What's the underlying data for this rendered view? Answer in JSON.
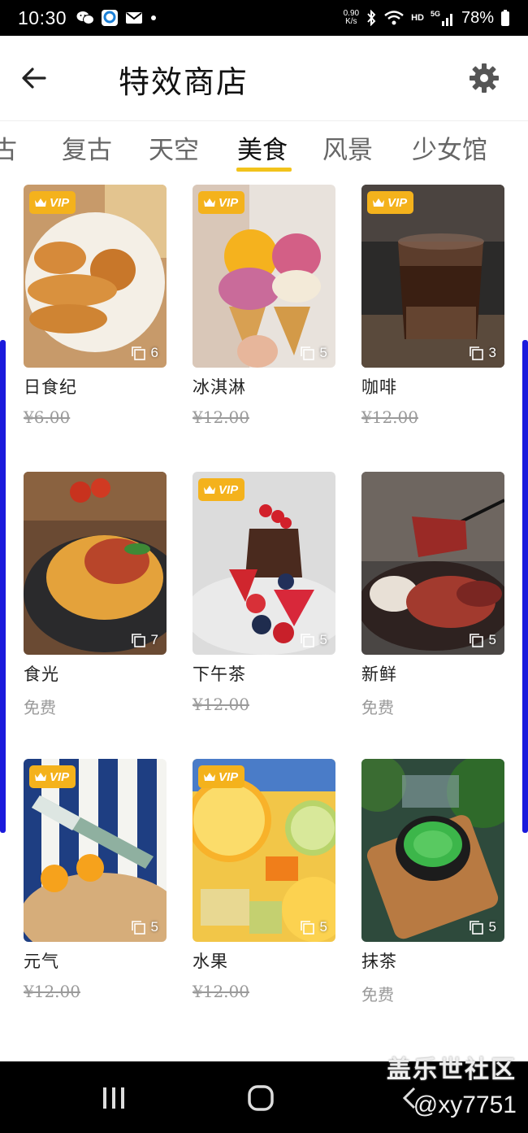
{
  "status_bar": {
    "time": "10:30",
    "speed_value": "0.90",
    "speed_unit": "K/s",
    "hd": "HD",
    "network": "5G",
    "battery": "78%"
  },
  "header": {
    "title": "特效商店"
  },
  "tabs": [
    {
      "label": "古"
    },
    {
      "label": "复古"
    },
    {
      "label": "天空"
    },
    {
      "label": "美食"
    },
    {
      "label": "风景"
    },
    {
      "label": "少女馆"
    }
  ],
  "active_tab": "美食",
  "vip_label": "VIP",
  "products": [
    {
      "name": "日食纪",
      "price": "¥6.00",
      "count": "6",
      "vip": true
    },
    {
      "name": "冰淇淋",
      "price": "¥12.00",
      "count": "5",
      "vip": true
    },
    {
      "name": "咖啡",
      "price": "¥12.00",
      "count": "3",
      "vip": true
    },
    {
      "name": "食光",
      "price": "免费",
      "count": "7",
      "vip": false
    },
    {
      "name": "下午茶",
      "price": "¥12.00",
      "count": "5",
      "vip": true
    },
    {
      "name": "新鲜",
      "price": "免费",
      "count": "5",
      "vip": false
    },
    {
      "name": "元气",
      "price": "¥12.00",
      "count": "5",
      "vip": true
    },
    {
      "name": "水果",
      "price": "¥12.00",
      "count": "5",
      "vip": true
    },
    {
      "name": "抹茶",
      "price": "免费",
      "count": "5",
      "vip": false
    }
  ],
  "watermark": {
    "line1": "盖乐世社区",
    "line2": "@xy7751"
  },
  "colors": {
    "accent": "#f2c31b",
    "vip_badge": "#f4b21c",
    "edge_bar": "#1a1adc"
  }
}
